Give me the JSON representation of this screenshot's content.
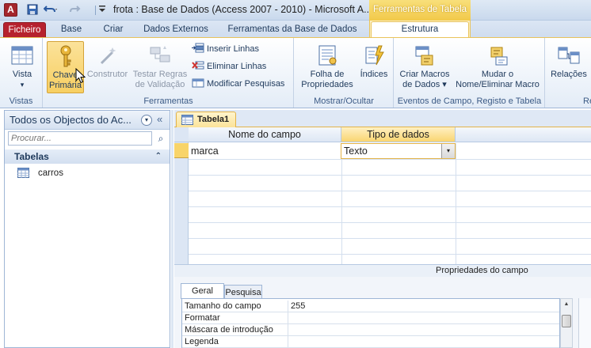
{
  "titlebar": {
    "app_icon_letter": "A",
    "title": "frota : Base de Dados (Access 2007 - 2010)  -  Microsoft A...",
    "context_header": "Ferramentas de Tabela",
    "qat": {
      "save_icon": "save-icon",
      "undo_icon": "undo-icon",
      "redo_icon": "redo-icon",
      "customize_icon": "customize-qat-icon"
    }
  },
  "tabs": {
    "file": "Ficheiro",
    "home": "Base",
    "create": "Criar",
    "external": "Dados Externos",
    "dbtools": "Ferramentas da Base de Dados",
    "design": "Estrutura"
  },
  "ribbon": {
    "views": {
      "label": "Vistas",
      "view_btn": "Vista",
      "view_arrow": "▾"
    },
    "tools": {
      "label": "Ferramentas",
      "primary_key_l1": "Chave",
      "primary_key_l2": "Primária",
      "builder": "Construtor",
      "test_rules_l1": "Testar Regras",
      "test_rules_l2": "de Validação",
      "insert_rows": "Inserir Linhas",
      "delete_rows": "Eliminar Linhas",
      "modify_lookups": "Modificar Pesquisas"
    },
    "show_hide": {
      "label": "Mostrar/Ocultar",
      "property_sheet_l1": "Folha de",
      "property_sheet_l2": "Propriedades",
      "indexes": "Índices"
    },
    "events": {
      "label": "Eventos de Campo, Registo e Tabela",
      "create_macros_l1": "Criar Macros",
      "create_macros_l2": "de Dados ▾",
      "rename_macro_l1": "Mudar o",
      "rename_macro_l2": "Nome/Eliminar Macro"
    },
    "relationships": {
      "label": "Re",
      "relations": "Relações"
    }
  },
  "nav": {
    "title": "Todos os Objectos do Ac...",
    "dropdown_icon": "▾",
    "collapse_icon": "«",
    "search_placeholder": "Procurar...",
    "search_icon": "⌕",
    "group_label": "Tabelas",
    "group_chevron": "⌃",
    "items": [
      {
        "label": "carros"
      }
    ]
  },
  "document": {
    "tab_label": "Tabela1",
    "columns": [
      "Nome do campo",
      "Tipo de dados"
    ],
    "rows": [
      {
        "field_name": "marca",
        "data_type": "Texto"
      }
    ],
    "combo_arrow": "▾"
  },
  "properties": {
    "title": "Propriedades do campo",
    "tabs": [
      "Geral",
      "Pesquisa"
    ],
    "rows": [
      {
        "name": "Tamanho do campo",
        "value": "255"
      },
      {
        "name": "Formatar",
        "value": ""
      },
      {
        "name": "Máscara de introdução",
        "value": ""
      },
      {
        "name": "Legenda",
        "value": ""
      }
    ]
  },
  "colors": {
    "accent_file": "#b6212e",
    "context": "#f2c94a",
    "ribbon_text": "#1e395b"
  }
}
